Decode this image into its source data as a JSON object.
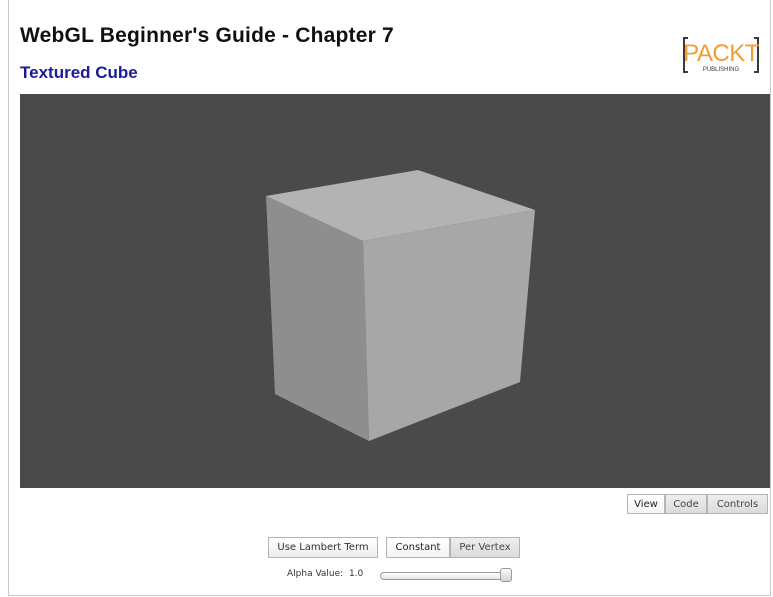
{
  "header": {
    "title": "WebGL Beginner's Guide - Chapter 7",
    "subtitle": "Textured Cube"
  },
  "logo": {
    "brand": "PACKT",
    "tagline": "PUBLISHING",
    "color": "#f39c34"
  },
  "viewport": {
    "background": "#4a4a4a",
    "cube_face_colors": {
      "top": "#b3b3b3",
      "left": "#8e8e8e",
      "right": "#a7a7a7"
    }
  },
  "tabs": [
    {
      "label": "View",
      "active": true
    },
    {
      "label": "Code",
      "active": false
    },
    {
      "label": "Controls",
      "active": false
    }
  ],
  "controls": {
    "lambert_label": "Use Lambert Term",
    "mode_options": [
      "Constant",
      "Per Vertex"
    ],
    "mode_selected": "Constant",
    "alpha_label": "Alpha Value:",
    "alpha_value": "1.0",
    "alpha_fraction": 1.0
  }
}
